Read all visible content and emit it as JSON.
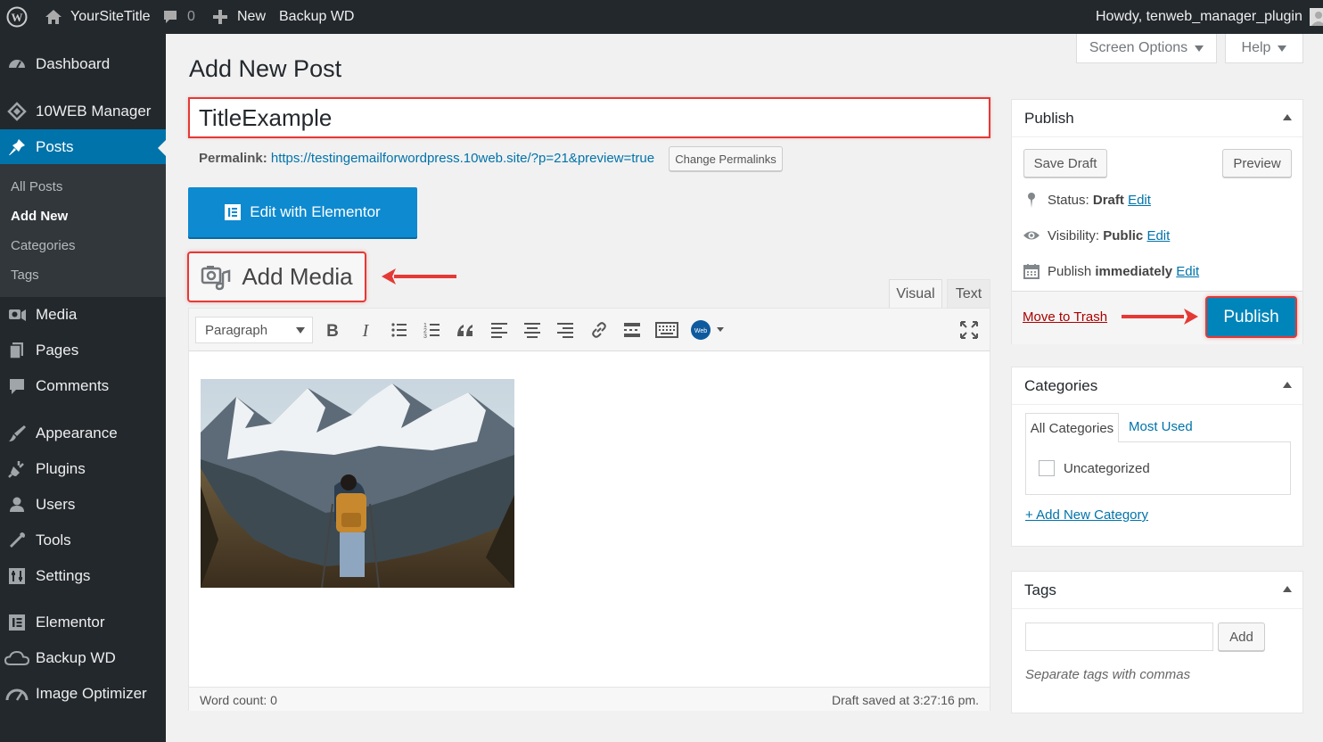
{
  "admin_bar": {
    "site_title": "YourSiteTitle",
    "comments_count": "0",
    "new_label": "New",
    "backup_label": "Backup WD",
    "greeting": "Howdy, tenweb_manager_plugin"
  },
  "sidebar": {
    "items": [
      {
        "label": "Dashboard",
        "icon": "dashboard-icon"
      },
      {
        "label": "10WEB Manager",
        "icon": "tenweb-icon"
      },
      {
        "label": "Posts",
        "icon": "pin-icon"
      },
      {
        "label": "Media",
        "icon": "media-icon"
      },
      {
        "label": "Pages",
        "icon": "pages-icon"
      },
      {
        "label": "Comments",
        "icon": "comment-icon"
      },
      {
        "label": "Appearance",
        "icon": "brush-icon"
      },
      {
        "label": "Plugins",
        "icon": "plug-icon"
      },
      {
        "label": "Users",
        "icon": "user-icon"
      },
      {
        "label": "Tools",
        "icon": "wrench-icon"
      },
      {
        "label": "Settings",
        "icon": "settings-icon"
      },
      {
        "label": "Elementor",
        "icon": "elementor-icon"
      },
      {
        "label": "Backup WD",
        "icon": "cloud-icon"
      },
      {
        "label": "Image Optimizer",
        "icon": "gauge-icon"
      }
    ],
    "posts_submenu": [
      "All Posts",
      "Add New",
      "Categories",
      "Tags"
    ]
  },
  "header": {
    "screen_options": "Screen Options",
    "help": "Help",
    "page_title": "Add New Post"
  },
  "post": {
    "title": "TitleExample",
    "permalink_label": "Permalink:",
    "permalink_url": "https://testingemailforwordpress.10web.site/?p=21&preview=true",
    "change_permalinks": "Change Permalinks",
    "edit_with_elementor": "Edit with Elementor",
    "add_media": "Add Media"
  },
  "editor": {
    "tab_visual": "Visual",
    "tab_text": "Text",
    "format_select": "Paragraph",
    "word_count": "Word count: 0",
    "draft_saved": "Draft saved at 3:27:16 pm."
  },
  "publish_box": {
    "title": "Publish",
    "save_draft": "Save Draft",
    "preview": "Preview",
    "status_label": "Status:",
    "status_value": "Draft",
    "visibility_label": "Visibility:",
    "visibility_value": "Public",
    "publish_label": "Publish",
    "publish_value": "immediately",
    "edit": "Edit",
    "move_to_trash": "Move to Trash",
    "publish_button": "Publish"
  },
  "categories_box": {
    "title": "Categories",
    "tab_all": "All Categories",
    "tab_most_used": "Most Used",
    "items": [
      "Uncategorized"
    ],
    "add_new": "+ Add New Category"
  },
  "tags_box": {
    "title": "Tags",
    "add_button": "Add",
    "hint": "Separate tags with commas"
  },
  "colors": {
    "admin_bar": "#23282d",
    "accent": "#0073aa",
    "highlight": "#e53935"
  }
}
